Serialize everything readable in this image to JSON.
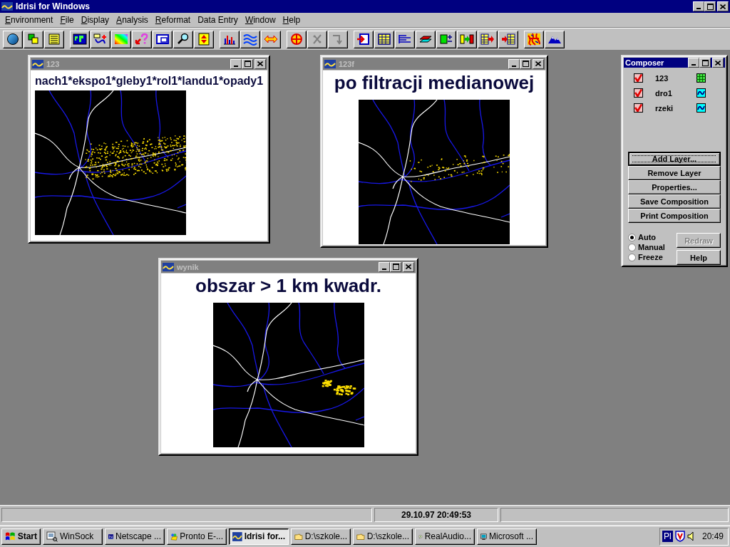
{
  "app": {
    "title": "Idrisi for Windows"
  },
  "menu": [
    {
      "label": "Environment",
      "mnemonic": true
    },
    {
      "label": "File",
      "mnemonic": true
    },
    {
      "label": "Display",
      "mnemonic": true
    },
    {
      "label": "Analysis",
      "mnemonic": true
    },
    {
      "label": "Reformat",
      "mnemonic": true
    },
    {
      "label": "Data Entry",
      "mnemonic": false
    },
    {
      "label": "Window",
      "mnemonic": true
    },
    {
      "label": "Help",
      "mnemonic": true
    }
  ],
  "windows": [
    {
      "title": "123",
      "active": false,
      "caption": "nach1*ekspo1*gleby1*rol1*landu1*opady1",
      "kind": "compact"
    },
    {
      "title": "123f",
      "active": false,
      "caption": "po filtracji medianowej",
      "kind": "banner"
    },
    {
      "title": "wynik",
      "active": false,
      "caption": "obszar > 1 km kwadr.",
      "kind": "banner"
    }
  ],
  "composer": {
    "title": "Composer",
    "active": true,
    "layers": [
      {
        "name": "123",
        "checked": true,
        "kind": "raster"
      },
      {
        "name": "dro1",
        "checked": true,
        "kind": "vector"
      },
      {
        "name": "rzeki",
        "checked": true,
        "kind": "vector"
      }
    ],
    "buttons": [
      {
        "label": "Add Layer...",
        "focused": true
      },
      {
        "label": "Remove Layer",
        "focused": false
      },
      {
        "label": "Properties...",
        "focused": false
      },
      {
        "label": "Save Composition",
        "focused": false
      },
      {
        "label": "Print Composition",
        "focused": false
      }
    ],
    "modes": [
      {
        "label": "Auto",
        "selected": true
      },
      {
        "label": "Manual",
        "selected": false
      },
      {
        "label": "Freeze",
        "selected": false
      }
    ],
    "side_buttons": [
      {
        "label": "Redraw",
        "disabled": true
      },
      {
        "label": "Help",
        "disabled": false
      }
    ]
  },
  "status_bar": {
    "datetime": "29.10.97 20:49:53"
  },
  "taskbar": {
    "start": "Start",
    "tasks": [
      {
        "label": "WinSock",
        "kind": "winsock",
        "selected": false
      },
      {
        "label": "Netscape ...",
        "kind": "netscape",
        "selected": false
      },
      {
        "label": "Pronto E-...",
        "kind": "pronto",
        "selected": false
      },
      {
        "label": "Idrisi for...",
        "kind": "idrisi",
        "selected": true
      },
      {
        "label": "D:\\szkole...",
        "kind": "folder",
        "selected": false
      },
      {
        "label": "D:\\szkole...",
        "kind": "folder",
        "selected": false
      },
      {
        "label": "RealAudio...",
        "kind": "realaudio",
        "selected": false
      },
      {
        "label": "Microsoft ...",
        "kind": "monitor",
        "selected": false
      }
    ],
    "tray": {
      "language": "Pl",
      "clock": "20:49"
    }
  }
}
